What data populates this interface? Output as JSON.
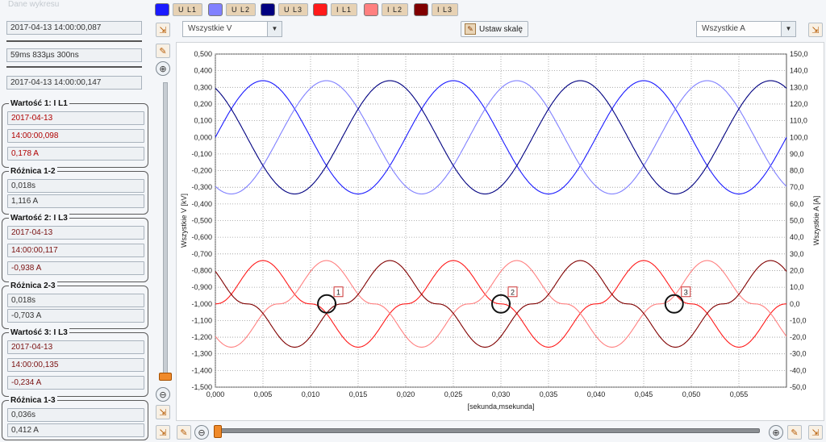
{
  "left_panel": {
    "header_label": "Dane wykresu",
    "start_value": "2017-04-13 14:00:00,087",
    "duration_value": "59ms 833µs 300ns",
    "end_value": "2017-04-13 14:00:00,147",
    "value1": {
      "title": "Wartość 1: I L1",
      "date": "2017-04-13",
      "time": "14:00:00,098",
      "amp": "0,178 A"
    },
    "diff12": {
      "title": "Różnica 1-2",
      "time": "0,018s",
      "amp": "1,116 A"
    },
    "value2": {
      "title": "Wartość 2: I L3",
      "date": "2017-04-13",
      "time": "14:00:00,117",
      "amp": "-0,938 A"
    },
    "diff23": {
      "title": "Różnica 2-3",
      "time": "0,018s",
      "amp": "-0,703 A"
    },
    "value3": {
      "title": "Wartość 3: I L3",
      "date": "2017-04-13",
      "time": "14:00:00,135",
      "amp": "-0,234 A"
    },
    "diff13": {
      "title": "Różnica 1-3",
      "time": "0,036s",
      "amp": "0,412 A"
    }
  },
  "legend": [
    {
      "label": "U L1",
      "color": "#1a1aff"
    },
    {
      "label": "U L2",
      "color": "#8080ff"
    },
    {
      "label": "U L3",
      "color": "#000080"
    },
    {
      "label": "I L1",
      "color": "#ff1a1a"
    },
    {
      "label": "I L2",
      "color": "#ff8080"
    },
    {
      "label": "I L3",
      "color": "#800000"
    }
  ],
  "toolbar": {
    "voltage_dropdown": "Wszystkie V",
    "current_dropdown": "Wszystkie A",
    "set_scale_label": "Ustaw skalę"
  },
  "chart_data": {
    "type": "line",
    "xlabel": "[sekunda,msekunda]",
    "ylabel_left": "Wszystkie V [kV]",
    "ylabel_right": "Wszystkie A [A]",
    "xlim": [
      0,
      0.06
    ],
    "ylim_left": [
      -1.5,
      0.5
    ],
    "ylim_right": [
      -50,
      150
    ],
    "x_ticks": [
      "0,000",
      "0,005",
      "0,010",
      "0,015",
      "0,020",
      "0,025",
      "0,030",
      "0,035",
      "0,040",
      "0,045",
      "0,050",
      "0,055"
    ],
    "y_left_ticks": [
      "0,500",
      "0,400",
      "0,300",
      "0,200",
      "0,100",
      "0,000",
      "-0,100",
      "-0,200",
      "-0,300",
      "-0,400",
      "-0,500",
      "-0,600",
      "-0,700",
      "-0,800",
      "-0,900",
      "-1,000",
      "-1,100",
      "-1,200",
      "-1,300",
      "-1,400",
      "-1,500"
    ],
    "y_right_ticks": [
      "150,0",
      "140,0",
      "130,0",
      "120,0",
      "110,0",
      "100,0",
      "90,0",
      "80,0",
      "70,0",
      "60,0",
      "50,0",
      "40,0",
      "30,0",
      "20,0",
      "10,0",
      "0,0",
      "-10,0",
      "-20,0",
      "-30,0",
      "-40,0",
      "-50,0"
    ],
    "grid": true,
    "frequency_hz": 50,
    "series": [
      {
        "name": "U L1",
        "axis": "left",
        "kind": "sine",
        "amplitude": 0.34,
        "offset": 0.0,
        "phase_deg": 0,
        "color": "#1a1aff"
      },
      {
        "name": "U L2",
        "axis": "left",
        "kind": "sine",
        "amplitude": 0.34,
        "offset": 0.0,
        "phase_deg": -120,
        "color": "#8080ff"
      },
      {
        "name": "U L3",
        "axis": "left",
        "kind": "sine",
        "amplitude": 0.34,
        "offset": 0.0,
        "phase_deg": 120,
        "color": "#000080"
      },
      {
        "name": "I L1",
        "axis": "right",
        "kind": "pulse",
        "amplitude": 0.3,
        "offset": -1.0,
        "phase_deg": 0,
        "color": "#ff1a1a"
      },
      {
        "name": "I L2",
        "axis": "right",
        "kind": "pulse",
        "amplitude": 0.3,
        "offset": -1.0,
        "phase_deg": -120,
        "color": "#ff8080"
      },
      {
        "name": "I L3",
        "axis": "right",
        "kind": "pulse",
        "amplitude": 0.3,
        "offset": -1.0,
        "phase_deg": 120,
        "color": "#800000"
      }
    ],
    "markers": [
      {
        "label": "1",
        "x": 0.0117,
        "y": -1.0
      },
      {
        "label": "2",
        "x": 0.03,
        "y": -1.0
      },
      {
        "label": "3",
        "x": 0.0482,
        "y": -1.0
      }
    ]
  }
}
